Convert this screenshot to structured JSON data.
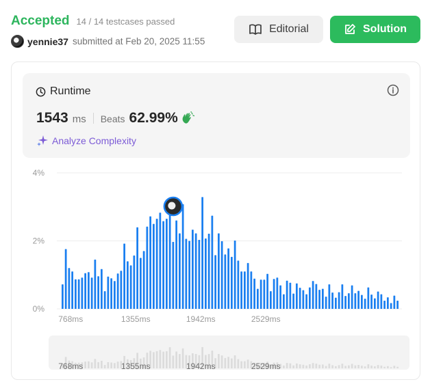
{
  "header": {
    "status": "Accepted",
    "testcases": "14 / 14 testcases passed",
    "username": "yennie37",
    "submitted": "submitted at Feb 20, 2025 11:55",
    "editorial_label": "Editorial",
    "solution_label": "Solution"
  },
  "runtime": {
    "title": "Runtime",
    "value": "1543",
    "unit": "ms",
    "beats_label": "Beats",
    "beats_value": "62.99%",
    "analyze_label": "Analyze Complexity"
  },
  "colors": {
    "accepted": "#2db55d",
    "solution_button": "#2cbb5d",
    "bar": "#1a7ff0",
    "analyze": "#7c5bd6"
  },
  "icons": [
    "book-icon",
    "edit-icon",
    "clock-icon",
    "info-icon",
    "clap-icon",
    "sparkle-icon"
  ],
  "chart_data": {
    "type": "bar",
    "ylabel_ticks": [
      "0%",
      "2%",
      "4%"
    ],
    "ylim": [
      0,
      4
    ],
    "x_ticks": [
      "768ms",
      "1355ms",
      "1942ms",
      "2529ms"
    ],
    "x_tick_values": [
      768,
      1355,
      1942,
      2529
    ],
    "x_start": 680,
    "bin_width": 29.35,
    "grid": true,
    "highlight_bin": 34,
    "values": [
      0.72,
      1.76,
      1.2,
      1.1,
      0.87,
      0.87,
      0.92,
      1.05,
      1.08,
      0.92,
      1.45,
      0.96,
      1.17,
      0.52,
      0.95,
      0.9,
      0.82,
      1.04,
      1.12,
      1.92,
      1.4,
      1.28,
      1.57,
      2.4,
      1.5,
      1.7,
      2.42,
      2.72,
      2.5,
      2.65,
      2.83,
      2.58,
      2.65,
      3.27,
      1.97,
      2.6,
      2.22,
      3.08,
      2.06,
      2.0,
      2.33,
      2.22,
      2.03,
      3.29,
      2.07,
      2.21,
      2.74,
      1.58,
      2.22,
      1.99,
      1.6,
      1.78,
      1.53,
      2.01,
      1.42,
      1.1,
      1.1,
      1.35,
      1.1,
      0.89,
      0.59,
      0.86,
      0.86,
      1.03,
      0.52,
      0.88,
      0.92,
      0.69,
      0.43,
      0.83,
      0.77,
      0.45,
      0.75,
      0.62,
      0.55,
      0.43,
      0.63,
      0.82,
      0.73,
      0.56,
      0.59,
      0.36,
      0.72,
      0.48,
      0.33,
      0.49,
      0.72,
      0.38,
      0.46,
      0.69,
      0.46,
      0.53,
      0.41,
      0.3,
      0.63,
      0.42,
      0.31,
      0.51,
      0.43,
      0.24,
      0.34,
      0.17,
      0.39,
      0.24
    ]
  }
}
